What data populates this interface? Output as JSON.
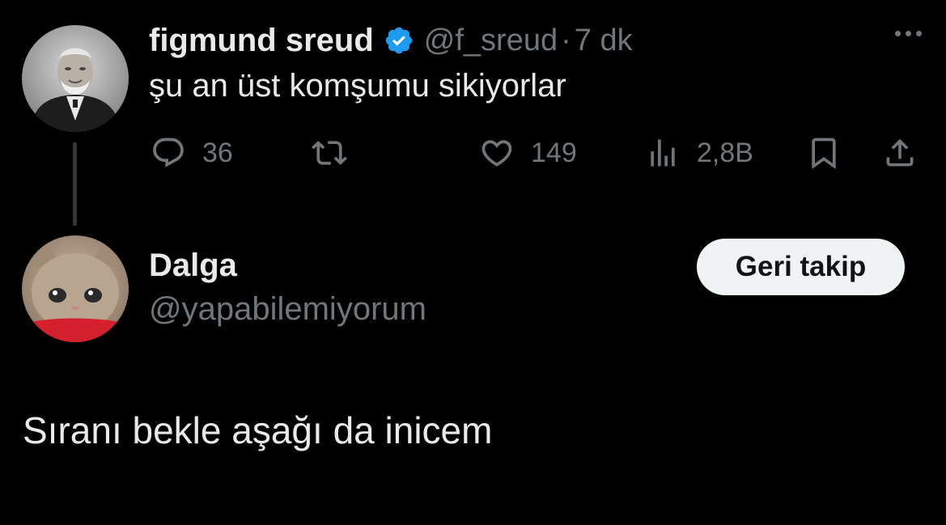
{
  "tweet": {
    "display_name": "figmund sreud",
    "verified_icon": "verified-badge-icon",
    "handle": "@f_sreud",
    "separator": "·",
    "time": "7 dk",
    "text": "şu an üst komşumu sikiyorlar",
    "actions": {
      "replies": "36",
      "retweets": "",
      "likes": "149",
      "views": "2,8B"
    },
    "colors": {
      "verified": "#1d9bf0",
      "muted": "#71767b",
      "text": "#e7e9ea"
    }
  },
  "reply": {
    "display_name": "Dalga",
    "handle": "@yapabilemiyorum",
    "follow_label": "Geri takip",
    "text": "Sıranı bekle aşağı da inicem"
  }
}
